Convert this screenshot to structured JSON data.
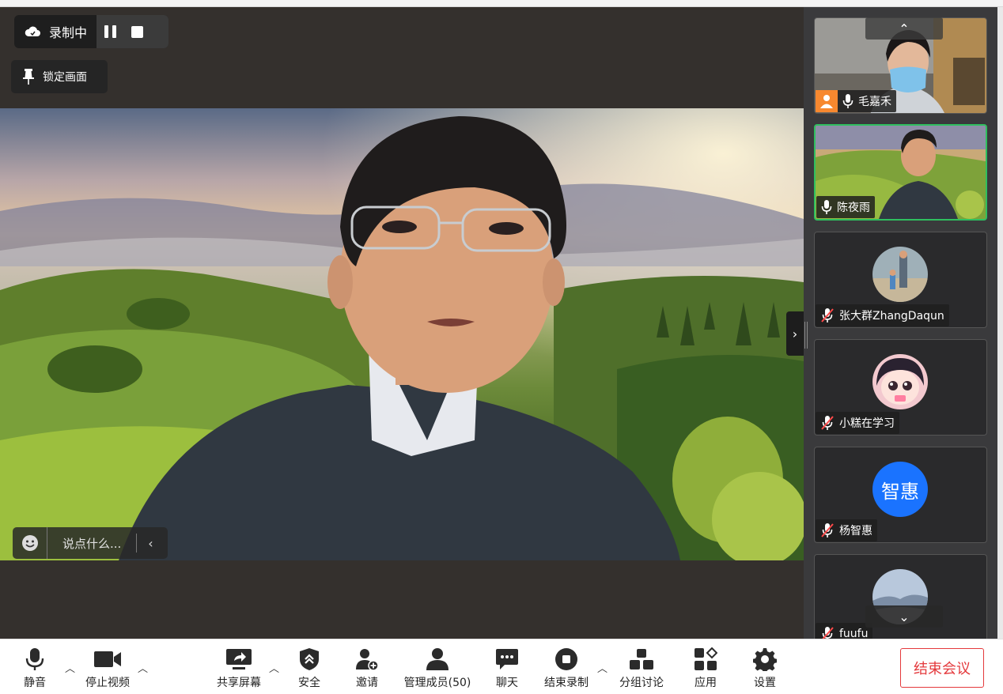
{
  "recording": {
    "status_label": "录制中"
  },
  "lock_view": {
    "label": "锁定画面"
  },
  "chat": {
    "placeholder": "说点什么..."
  },
  "participants": [
    {
      "name": "毛嘉禾",
      "mic": "on",
      "role": "host",
      "video": true
    },
    {
      "name": "陈夜雨",
      "mic": "on",
      "video": true,
      "active": true
    },
    {
      "name": "张大群ZhangDaqun",
      "mic": "muted",
      "video": false
    },
    {
      "name": "小糕在学习",
      "mic": "muted",
      "video": false
    },
    {
      "name": "杨智惠",
      "mic": "muted",
      "video": false,
      "avatar_text": "智惠"
    },
    {
      "name": "fuufu",
      "mic": "muted",
      "video": false
    }
  ],
  "toolbar": {
    "mute": "静音",
    "stop_video": "停止视频",
    "share_screen": "共享屏幕",
    "security": "安全",
    "invite": "邀请",
    "manage_members": "管理成员(50)",
    "chat": "聊天",
    "end_recording": "结束录制",
    "breakout": "分组讨论",
    "apps": "应用",
    "settings": "设置",
    "end_meeting": "结束会议"
  },
  "colors": {
    "active_border": "#2fbf5f",
    "end_meeting": "#e4393c",
    "avatar_blue": "#1a73ff",
    "host_badge": "#f7882f"
  }
}
